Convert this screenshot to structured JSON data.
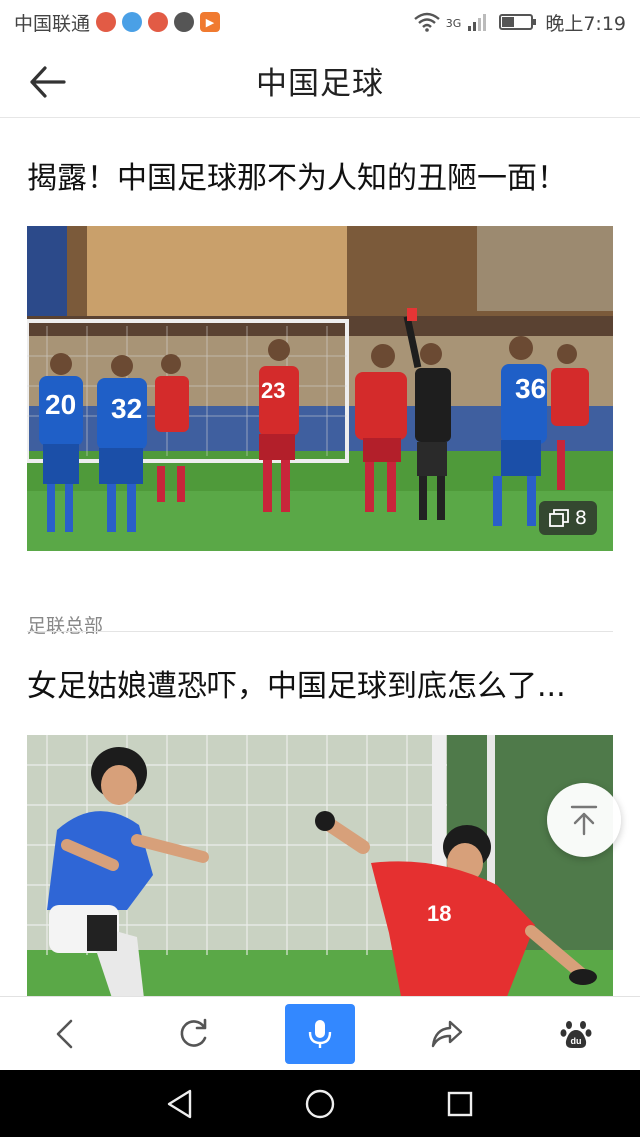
{
  "status_bar": {
    "carrier": "中国联通",
    "network": "3G",
    "time": "晚上7:19",
    "battery_level": 0.4
  },
  "header": {
    "title": "中国足球"
  },
  "articles": [
    {
      "title": "揭露！中国足球那不为人知的丑陋一面！",
      "image_count": "8",
      "source": "足联总部",
      "jersey_numbers": [
        "20",
        "32",
        "23",
        "36"
      ]
    },
    {
      "title": "女足姑娘遭恐吓，中国足球到底怎么了...",
      "jersey_numbers": [
        "18"
      ]
    }
  ],
  "toolbar": {
    "items": [
      "back-icon",
      "refresh-icon",
      "microphone-icon",
      "share-icon",
      "baidu-paw-icon"
    ],
    "baidu_text": "du"
  },
  "colors": {
    "accent": "#3388ff",
    "red_team": "#d42b2b",
    "blue_team": "#1f5fc7",
    "pitch": "#4f9a3a"
  }
}
